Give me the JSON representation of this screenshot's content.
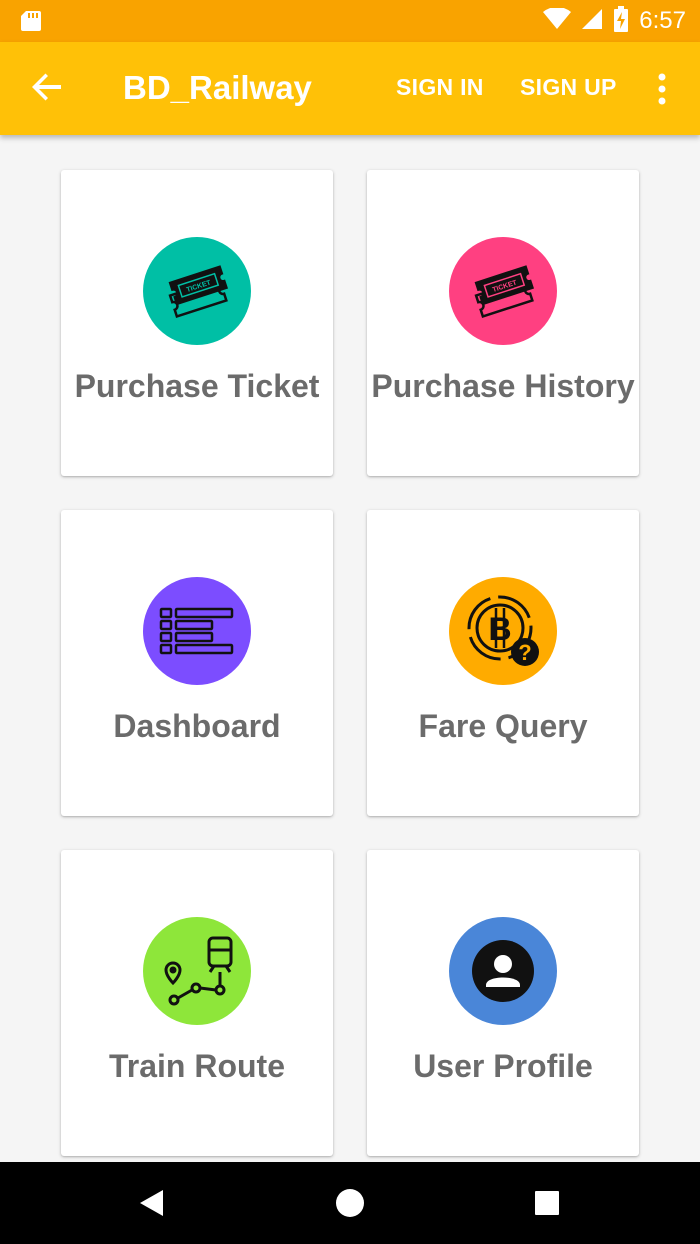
{
  "status_bar": {
    "time": "6:57",
    "icons": [
      "sd-card-icon",
      "wifi-icon",
      "signal-icon",
      "battery-charging-icon"
    ],
    "background": "#f9a300"
  },
  "app_bar": {
    "title": "BD_Railway",
    "sign_in_label": "SIGN IN",
    "sign_up_label": "SIGN UP",
    "icons": [
      "back-arrow-icon",
      "more-vert-icon"
    ],
    "background": "#ffc107"
  },
  "menu": [
    {
      "label": "Purchase Ticket",
      "icon": "ticket-icon",
      "color": "#00bfa5"
    },
    {
      "label": "Purchase History",
      "icon": "ticket-icon",
      "color": "#ff4081"
    },
    {
      "label": "Dashboard",
      "icon": "list-icon",
      "color": "#7c4dff"
    },
    {
      "label": "Fare Query",
      "icon": "fare-query-icon",
      "color": "#ffab00"
    },
    {
      "label": "Train Route",
      "icon": "train-route-icon",
      "color": "#8ee63a"
    },
    {
      "label": "User Profile",
      "icon": "user-icon",
      "color": "#4a86d8"
    }
  ],
  "nav_bar": {
    "icons": [
      "back-triangle-icon",
      "home-circle-icon",
      "recents-square-icon"
    ]
  }
}
